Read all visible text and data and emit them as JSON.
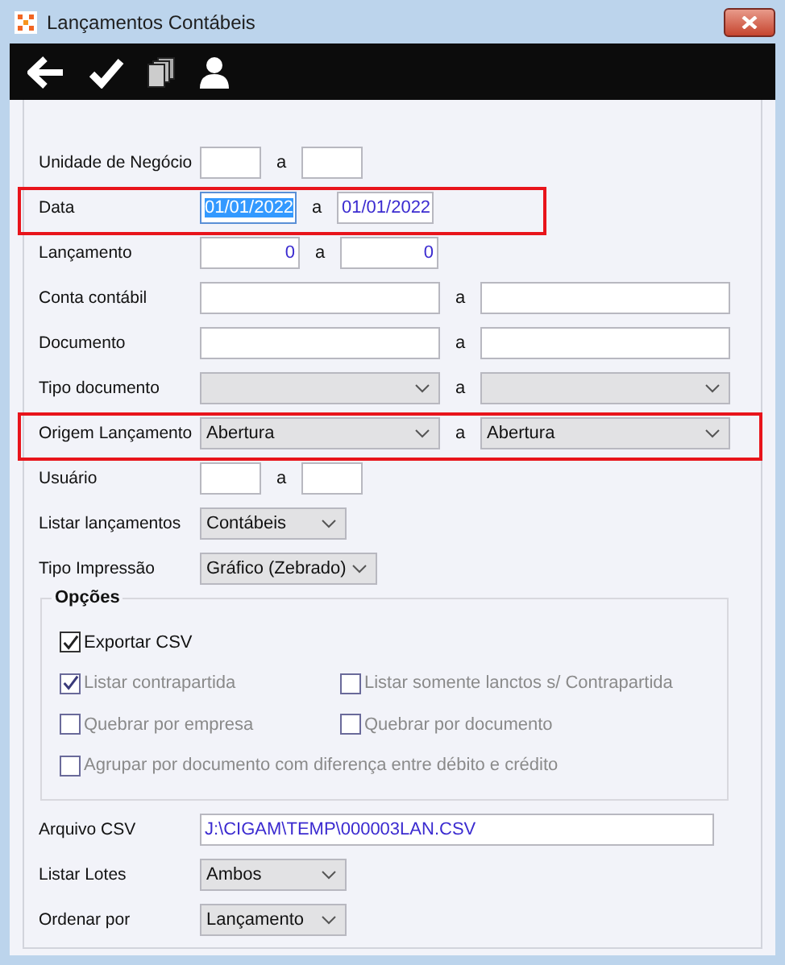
{
  "window": {
    "title": "Lançamentos Contábeis"
  },
  "toolbar": [
    {
      "kind": "back"
    },
    {
      "kind": "confirm"
    },
    {
      "kind": "copy"
    },
    {
      "kind": "user"
    }
  ],
  "fields": [
    {
      "label": "Unidade de Negócio",
      "kind": "range-short",
      "separator": "a"
    },
    {
      "label": "Data",
      "kind": "range-date",
      "highlighted": true,
      "separator": "a",
      "from": {
        "value": "01/01/2022",
        "focused": true
      },
      "to": {
        "value": "01/01/2022",
        "focused": false
      }
    },
    {
      "label": "Lançamento",
      "kind": "range-number",
      "separator": "a",
      "from": {
        "value": "0"
      },
      "to": {
        "value": "0"
      }
    },
    {
      "label": "Conta contábil",
      "kind": "range-wide",
      "separator": "a"
    },
    {
      "label": "Documento",
      "kind": "range-wide",
      "separator": "a"
    },
    {
      "label": "Tipo documento",
      "kind": "range-select",
      "separator": "a"
    },
    {
      "label": "Origem Lançamento",
      "kind": "range-select",
      "highlighted": true,
      "separator": "a",
      "from": {
        "value": "Abertura"
      },
      "to": {
        "value": "Abertura"
      }
    },
    {
      "label": "Usuário",
      "kind": "range-short",
      "separator": "a"
    },
    {
      "label": "Listar lançamentos",
      "kind": "select",
      "value": "Contábeis"
    },
    {
      "label": "Tipo Impressão",
      "kind": "select-wide",
      "value": "Gráfico (Zebrado)"
    }
  ],
  "options": {
    "title": "Opções",
    "rows": [
      [
        {
          "label": "Exportar CSV",
          "checked": true,
          "disabled": false
        }
      ],
      [
        {
          "label": "Listar contrapartida",
          "checked": true,
          "disabled": true
        },
        {
          "label": "Listar somente lanctos s/ Contrapartida",
          "checked": false,
          "disabled": true
        }
      ],
      [
        {
          "label": "Quebrar por empresa",
          "checked": false,
          "disabled": true
        },
        {
          "label": "Quebrar por documento",
          "checked": false,
          "disabled": true
        }
      ],
      [
        {
          "label": "Agrupar por documento com diferença entre débito e crédito",
          "checked": false,
          "disabled": true
        }
      ]
    ]
  },
  "extra_fields": [
    {
      "label": "Arquivo CSV",
      "kind": "text",
      "value": "J:\\CIGAM\\TEMP\\000003LAN.CSV"
    },
    {
      "label": "Listar Lotes",
      "kind": "select",
      "value": "Ambos"
    },
    {
      "label": "Ordenar por",
      "kind": "select",
      "value": "Lançamento"
    }
  ]
}
